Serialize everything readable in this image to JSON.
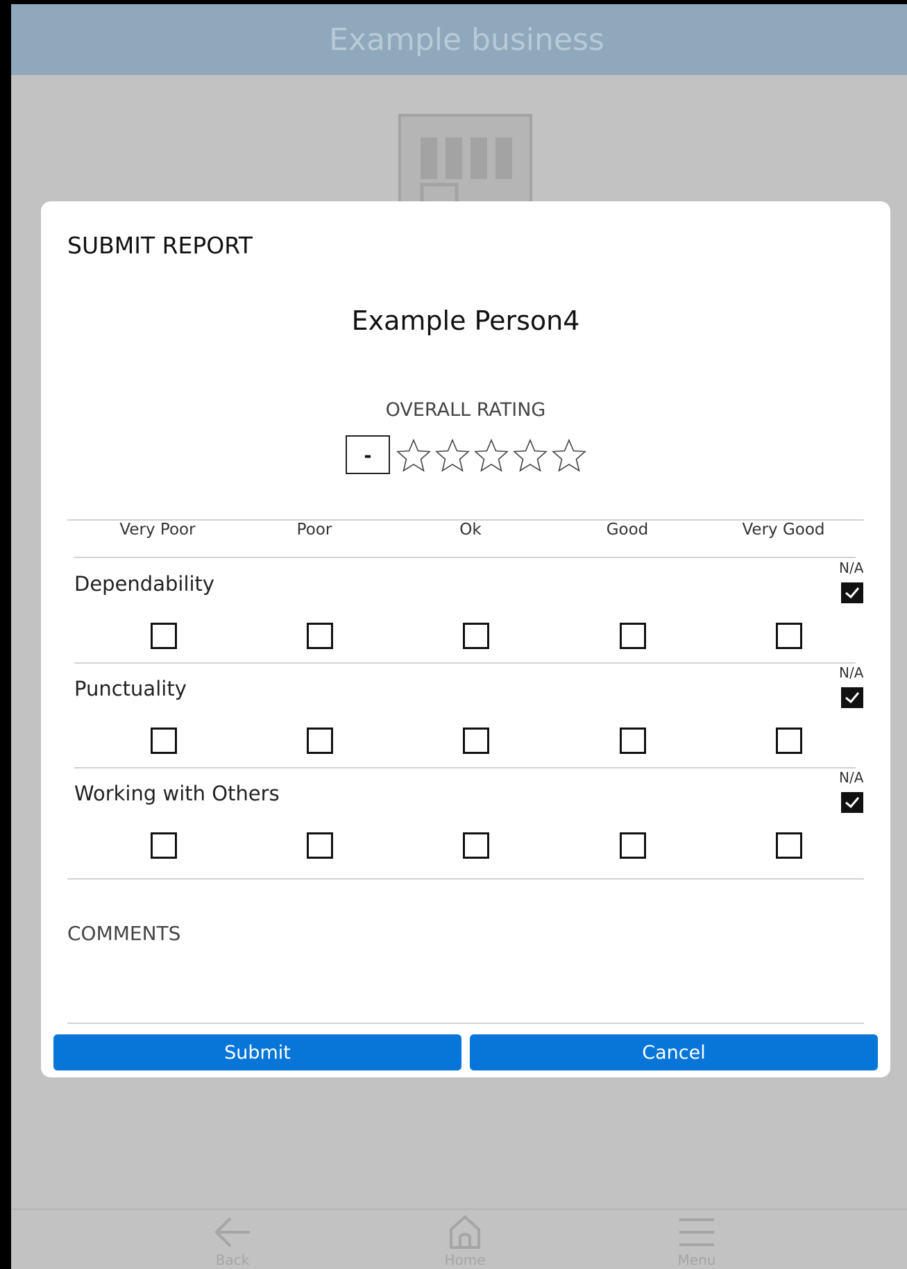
{
  "app": {
    "title": "Example business"
  },
  "dialog": {
    "title": "SUBMIT REPORT",
    "person_name": "Example Person4",
    "overall_rating": {
      "label": "OVERALL RATING",
      "value": "-",
      "stars_filled": 0,
      "stars_total": 5
    },
    "scale": [
      "Very Poor",
      "Poor",
      "Ok",
      "Good",
      "Very Good"
    ],
    "criteria": [
      {
        "label": "Dependability",
        "na_label": "N/A",
        "na_checked": true,
        "selected": null
      },
      {
        "label": "Punctuality",
        "na_label": "N/A",
        "na_checked": true,
        "selected": null
      },
      {
        "label": "Working with Others",
        "na_label": "N/A",
        "na_checked": true,
        "selected": null
      }
    ],
    "comments_label": "COMMENTS",
    "comments_value": "",
    "buttons": {
      "submit": "Submit",
      "cancel": "Cancel"
    }
  },
  "bottom_nav": [
    {
      "label": "Back",
      "icon": "arrow-left-icon"
    },
    {
      "label": "Home",
      "icon": "home-icon"
    },
    {
      "label": "Menu",
      "icon": "hamburger-menu-icon"
    }
  ],
  "colors": {
    "header": "#8fa8bc",
    "primary_button": "#0776d8",
    "background": "#c2c2c2"
  }
}
